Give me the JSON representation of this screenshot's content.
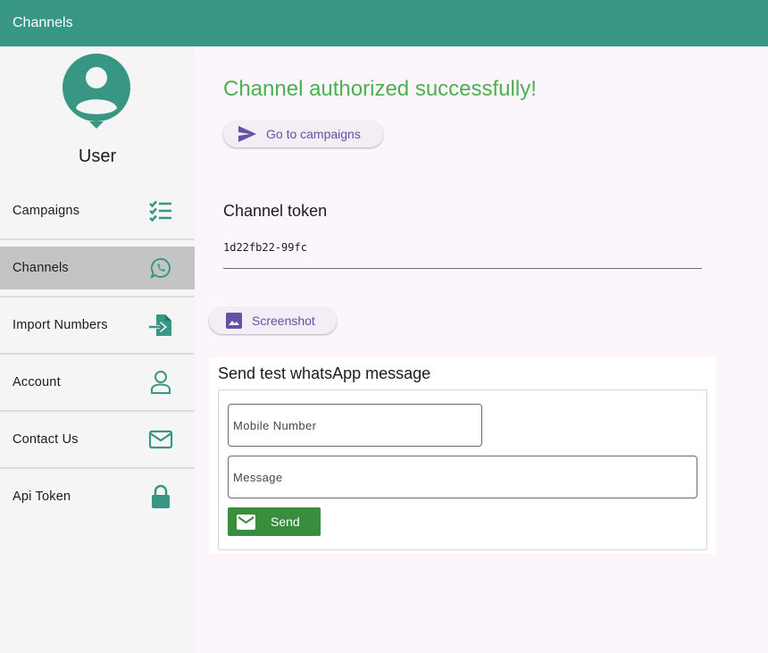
{
  "appbar": {
    "title": "Channels"
  },
  "sidebar": {
    "user_name": "User",
    "items": [
      {
        "label": "Campaigns",
        "icon": "checklist-icon"
      },
      {
        "label": "Channels",
        "icon": "whatsapp-icon",
        "active": true
      },
      {
        "label": "Import Numbers",
        "icon": "file-import-icon"
      },
      {
        "label": "Account",
        "icon": "person-icon"
      },
      {
        "label": "Contact Us",
        "icon": "mail-icon"
      },
      {
        "label": "Api Token",
        "icon": "lock-icon"
      }
    ]
  },
  "main": {
    "title": "Channel authorized successfully!",
    "go_to_campaigns_label": "Go to campaigns",
    "token_heading": "Channel token",
    "token_value": "1d22fb22-99fc",
    "screenshot_label": "Screenshot"
  },
  "test_message": {
    "heading": "Send test whatsApp message",
    "mobile_placeholder": "Mobile Number",
    "message_placeholder": "Message",
    "send_label": "Send"
  },
  "colors": {
    "primary": "#389685",
    "success_text": "#4caf50",
    "send_button": "#388e3c",
    "accent_text": "#6750a4",
    "active_item": "#c4c4c4"
  }
}
